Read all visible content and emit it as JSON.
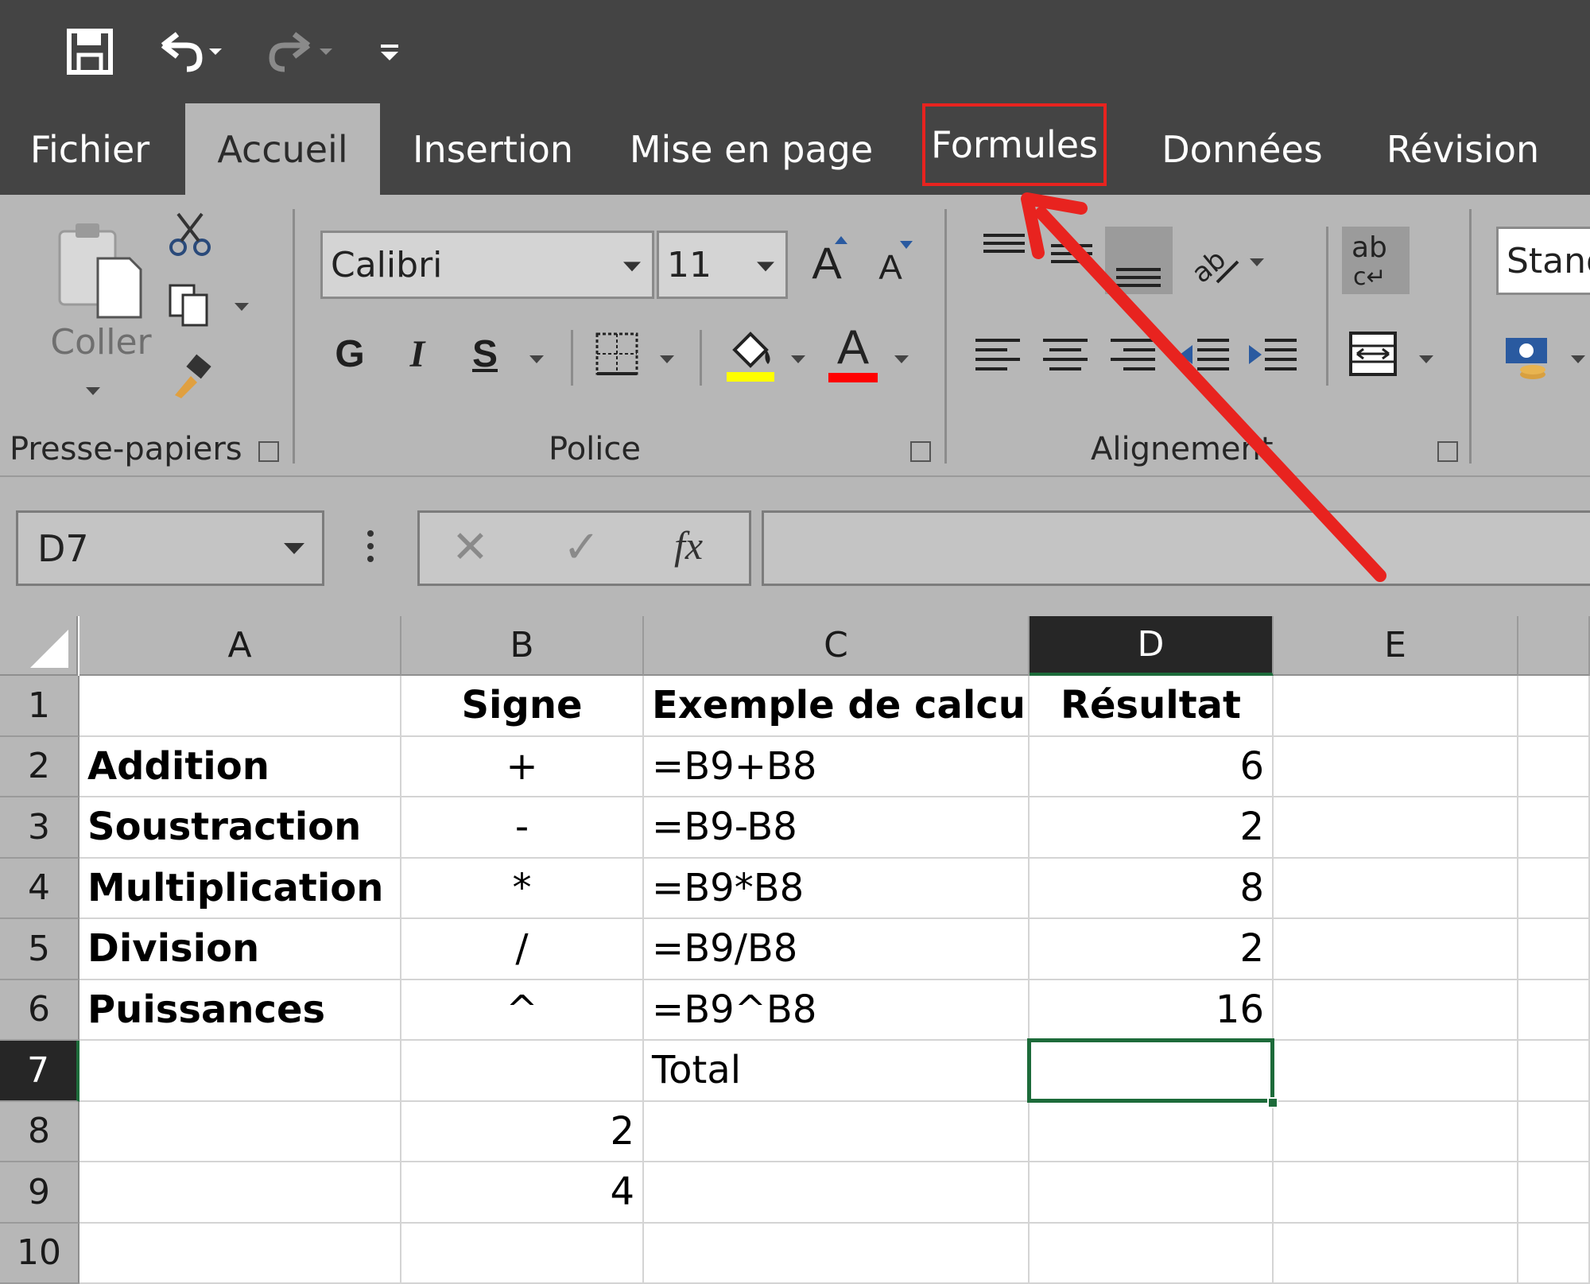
{
  "quick_access": {
    "save_icon": "save-icon",
    "undo_icon": "undo-icon",
    "redo_icon": "redo-icon",
    "customize_icon": "customize-icon"
  },
  "tabs": [
    {
      "label": "Fichier"
    },
    {
      "label": "Accueil"
    },
    {
      "label": "Insertion"
    },
    {
      "label": "Mise en page"
    },
    {
      "label": "Formules"
    },
    {
      "label": "Données"
    },
    {
      "label": "Révision"
    }
  ],
  "active_tab": "Accueil",
  "highlighted_tab": "Formules",
  "ribbon": {
    "clipboard": {
      "paste_label": "Coller",
      "group_label": "Presse-papiers"
    },
    "font": {
      "font_name": "Calibri",
      "font_size": "11",
      "bold": "G",
      "italic": "I",
      "underline": "S",
      "grow": "A",
      "shrink": "A",
      "font_color": "A",
      "group_label": "Police"
    },
    "alignment": {
      "group_label": "Alignement",
      "wrap": "ab"
    },
    "number": {
      "format": "Stand"
    }
  },
  "formula_bar": {
    "name_box": "D7",
    "cancel": "✕",
    "enter": "✓",
    "fx": "fx",
    "content": ""
  },
  "colors": {
    "annotation": "#e8231f",
    "fill_color": "#ffff00",
    "font_color": "#ff0000",
    "selection": "#1d6b3a"
  },
  "columns": [
    "A",
    "B",
    "C",
    "D",
    "E"
  ],
  "selected_column": "D",
  "rows": [
    "1",
    "2",
    "3",
    "4",
    "5",
    "6",
    "7",
    "8",
    "9",
    "10"
  ],
  "selected_row": "7",
  "cells": {
    "B1": "Signe",
    "C1": "Exemple de calcul",
    "D1": "Résultat",
    "A2": "Addition",
    "B2": "+",
    "C2": "=B9+B8",
    "D2": "6",
    "A3": "Soustraction",
    "B3": "-",
    "C3": "=B9-B8",
    "D3": "2",
    "A4": "Multiplication",
    "B4": "*",
    "C4": "=B9*B8",
    "D4": "8",
    "A5": "Division",
    "B5": "/",
    "C5": "=B9/B8",
    "D5": "2",
    "A6": "Puissances",
    "B6": "^",
    "C6": "=B9^B8",
    "D6": "16",
    "C7": "Total",
    "B8": "2",
    "B9": "4"
  }
}
